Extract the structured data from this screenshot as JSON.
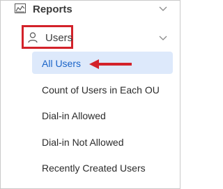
{
  "nav": {
    "reports": {
      "label": "Reports",
      "icon": "chart-icon",
      "expanded": true
    },
    "users": {
      "label": "Users",
      "icon": "user-icon",
      "expanded": true
    },
    "items": [
      {
        "label": "All Users",
        "active": true
      },
      {
        "label": "Count of Users in Each OU"
      },
      {
        "label": "Dial-in Allowed"
      },
      {
        "label": "Dial-in Not Allowed"
      },
      {
        "label": "Recently Created Users"
      }
    ]
  },
  "colors": {
    "highlight_border": "#d3222a",
    "active_bg": "#dde9fb",
    "active_text": "#1a64c8",
    "arrow": "#d3222a"
  }
}
